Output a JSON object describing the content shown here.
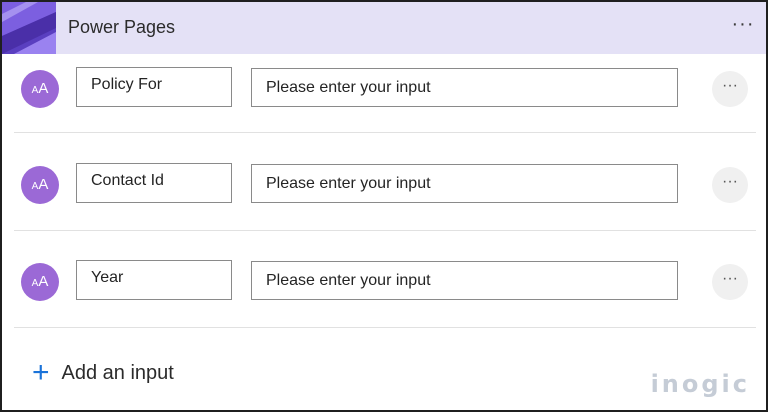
{
  "header": {
    "title": "Power Pages",
    "more_label": "···"
  },
  "inputs": [
    {
      "avatar_glyph": "A",
      "avatar_small": "A",
      "name": "Policy For",
      "placeholder": "Please enter your input",
      "more_label": "···"
    },
    {
      "avatar_glyph": "A",
      "avatar_small": "A",
      "name": "Contact Id",
      "placeholder": "Please enter your input",
      "more_label": "···"
    },
    {
      "avatar_glyph": "A",
      "avatar_small": "A",
      "name": "Year",
      "placeholder": "Please enter your input",
      "more_label": "···"
    }
  ],
  "add_input": {
    "icon": "plus-icon",
    "label": "Add an input"
  },
  "watermark": "inogic",
  "colors": {
    "header_bg": "#e4e1f6",
    "avatar_bg": "#9b69d6",
    "accent_plus": "#1a73d9"
  }
}
